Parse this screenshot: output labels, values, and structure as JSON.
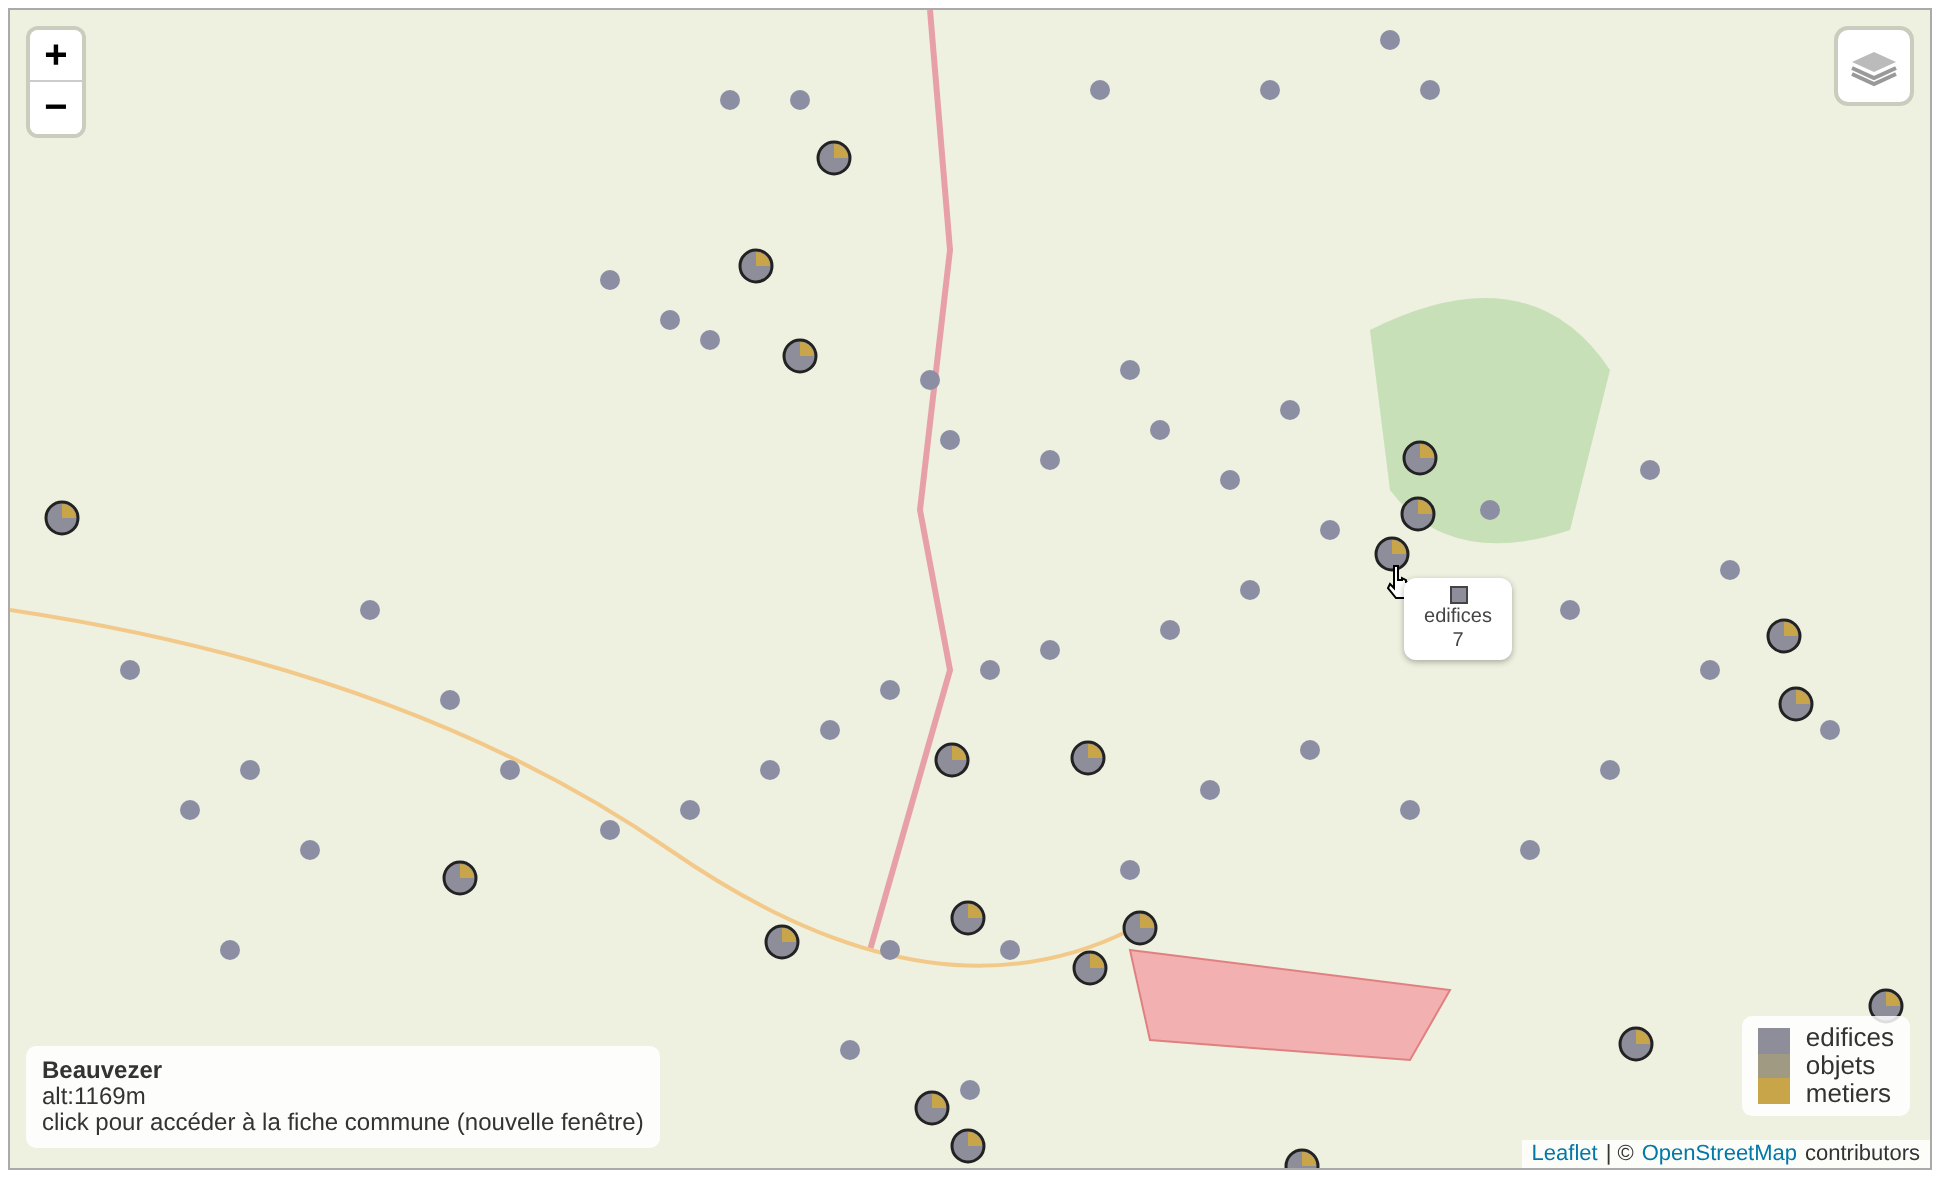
{
  "zoom_controls": [
    "+",
    "−"
  ],
  "tooltip": {
    "label": "edifices",
    "count": "7"
  },
  "legend": [
    {
      "label": "edifices",
      "color": "#8e8e9a"
    },
    {
      "label": "objets",
      "color": "#a09a82"
    },
    {
      "label": "metiers",
      "color": "#c9a54a"
    }
  ],
  "info_box": {
    "title": "Beauvezer",
    "altitude": "alt:1169m",
    "hint": "click pour accéder à la fiche commune (nouvelle fenêtre)"
  },
  "attribution": {
    "link_1": "Leaflet",
    "separator": "| ©",
    "link_2": "OpenStreetMap",
    "suffix": "contributors"
  }
}
